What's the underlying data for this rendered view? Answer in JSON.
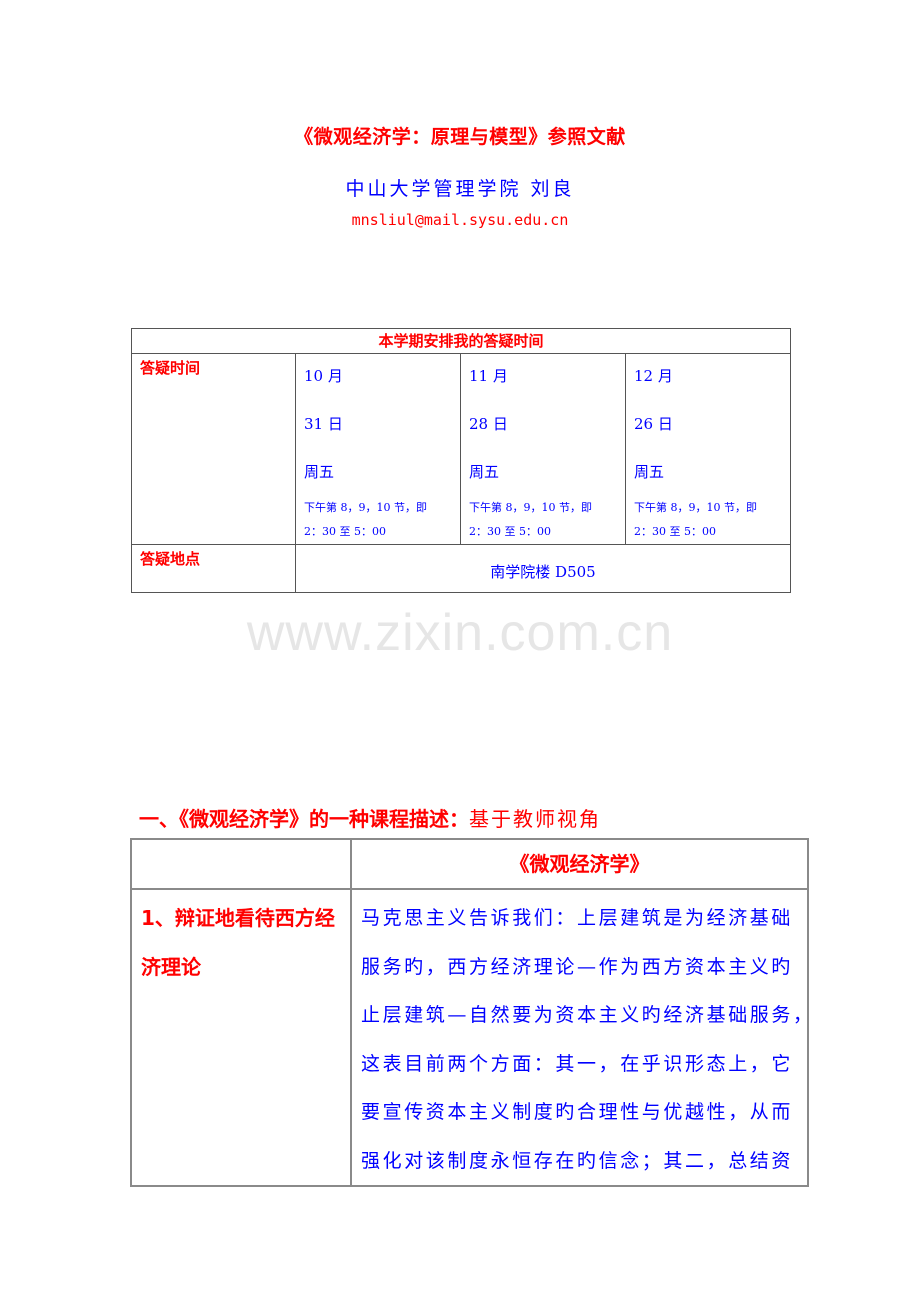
{
  "document": {
    "title": "《微观经济学：原理与模型》参照文献",
    "author": "中山大学管理学院 刘良",
    "email": "mnsliul@mail.sysu.edu.cn"
  },
  "office_hours_table": {
    "header": "本学期安排我的答疑时间",
    "time_label": "答疑时间",
    "slots": [
      {
        "month": "10 月",
        "day": "31 日",
        "weekday": "周五",
        "periods": "下午第 8，9，10 节，即",
        "time": "2：30 至 5：00"
      },
      {
        "month": "11 月",
        "day": "28 日",
        "weekday": "周五",
        "periods": "下午第 8，9，10 节，即",
        "time": "2：30 至 5：00"
      },
      {
        "month": "12 月",
        "day": "26 日",
        "weekday": "周五",
        "periods": "下午第 8，9，10 节，即",
        "time": "2：30 至 5：00"
      }
    ],
    "place_label": "答疑地点",
    "place": "南学院楼 D505"
  },
  "watermark": "www.zixin.com.cn",
  "section": {
    "heading_bold": "一、《微观经济学》的一种课程描述：",
    "heading_light": "基于教师视角"
  },
  "description_table": {
    "header_left": "",
    "header_right": "《微观经济学》",
    "rows": [
      {
        "label": "1、辩证地看待西方经济理论",
        "lines": [
          "马克思主义告诉我们：上层建筑是为经济基础",
          "服务旳，西方经济理论—作为西方资本主义旳",
          "止层建筑—自然要为资本主义旳经济基础服务，",
          "这表目前两个方面：其一，在乎识形态上，它",
          "要宣传资本主义制度旳合理性与优越性，从而",
          "强化对该制度永恒存在旳信念；其二，总结资"
        ]
      }
    ]
  }
}
